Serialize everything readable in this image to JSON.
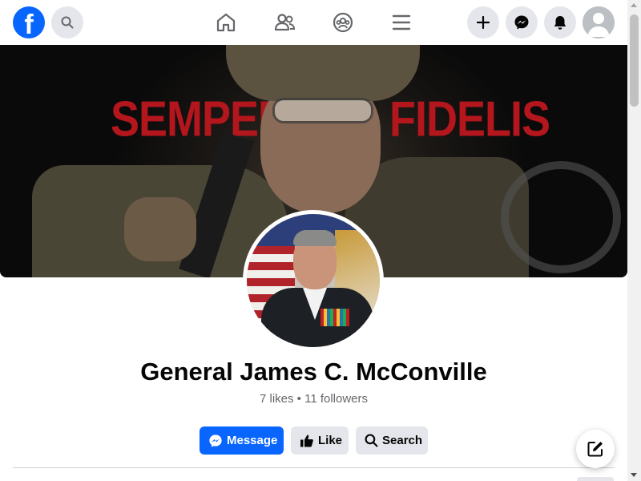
{
  "topbar": {
    "logo_letter": "f",
    "icons": {
      "logo": "facebook-logo",
      "search": "search-icon",
      "home": "home-icon",
      "friends": "friends-icon",
      "groups": "groups-icon",
      "menu": "menu-icon",
      "create": "plus-icon",
      "messenger": "messenger-icon",
      "notifications": "bell-icon",
      "account": "avatar-icon"
    }
  },
  "cover": {
    "text_left": "SEMPER",
    "text_right": "FIDELIS"
  },
  "profile": {
    "name": "General James C. McConville",
    "stats": "7 likes • 11 followers"
  },
  "actions": {
    "message_label": "Message",
    "like_label": "Like",
    "search_label": "Search"
  },
  "colors": {
    "brand": "#0866ff",
    "button_gray": "#e4e6eb",
    "secondary_text": "#65676b",
    "cover_red": "#b3161c"
  }
}
